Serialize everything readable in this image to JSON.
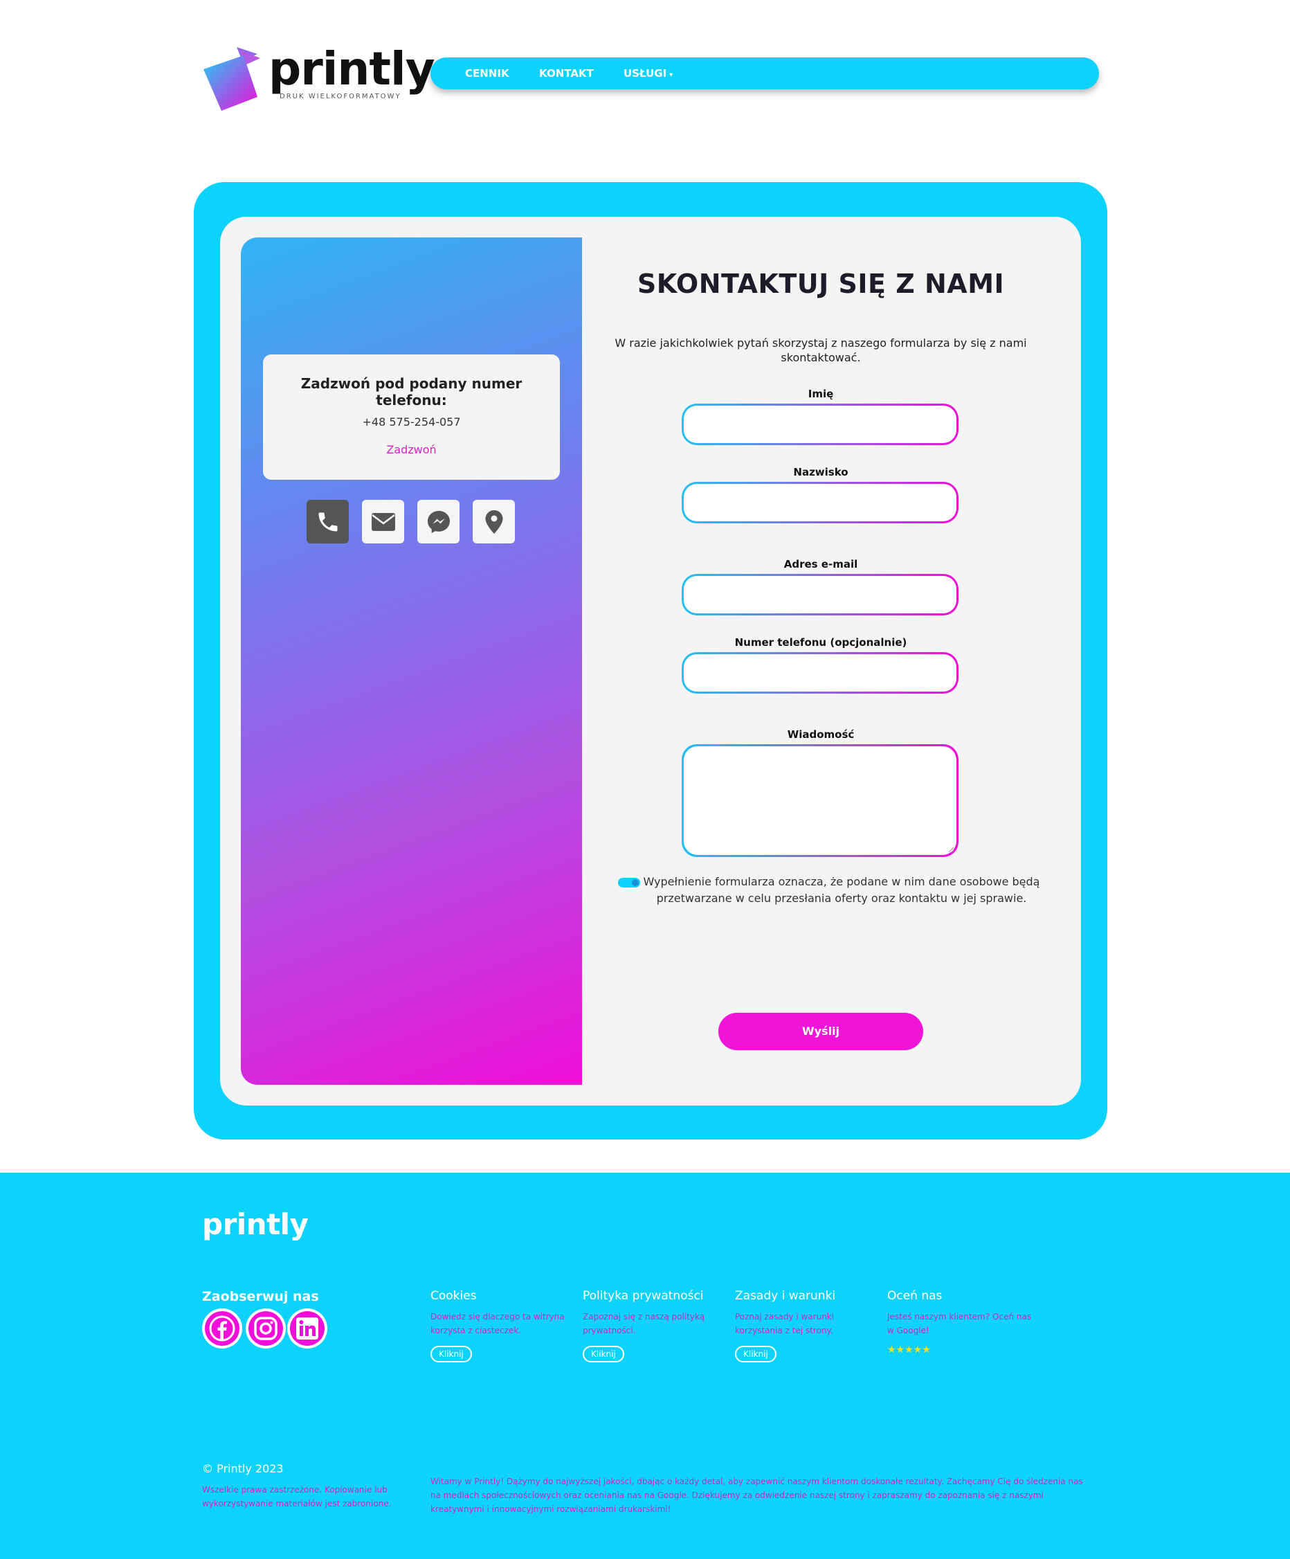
{
  "brand": {
    "name": "printly",
    "tagline": "DRUK WIELKOFORMATOWY"
  },
  "nav": {
    "items": [
      {
        "label": "CENNIK"
      },
      {
        "label": "KONTAKT"
      },
      {
        "label": "USŁUGI"
      }
    ],
    "dropdown_caret": "▾"
  },
  "call_card": {
    "title": "Zadzwoń pod podany numer telefonu:",
    "phone": "+48 575-254-057",
    "link": "Zadzwoń"
  },
  "contact_icons": [
    "phone-icon",
    "envelope-icon",
    "messenger-icon",
    "map-pin-icon"
  ],
  "form": {
    "title": "SKONTAKTUJ SIĘ Z NAMI",
    "intro": "W razie jakichkolwiek pytań skorzystaj z naszego formularza by się z nami skontaktować.",
    "fields": [
      {
        "label": "Imię",
        "value": ""
      },
      {
        "label": "Nazwisko",
        "value": ""
      },
      {
        "label": "Adres e-mail",
        "value": ""
      },
      {
        "label": "Numer telefonu (opcjonalnie)",
        "value": ""
      },
      {
        "label": "Wiadomość",
        "value": ""
      }
    ],
    "consent": "Wypełnienie formularza oznacza, że podane w nim dane osobowe będą przetwarzane w celu przesłania oferty oraz kontaktu w jej sprawie.",
    "consent_checked": true,
    "submit_label": "Wyślij"
  },
  "footer": {
    "logo": "printly",
    "follow_label": "Zaobserwuj nas",
    "social_icons": [
      "facebook-icon",
      "instagram-icon",
      "linkedin-icon"
    ],
    "columns": [
      {
        "heading": "Cookies",
        "text": "Dowiedz się dlaczego ta witryna korzysta z ciasteczek.",
        "button": "Kliknij"
      },
      {
        "heading": "Polityka prywatności",
        "text": "Zapoznaj się z naszą polityką prywatności.",
        "button": "Kliknij"
      },
      {
        "heading": "Zasady i warunki",
        "text": "Poznaj zasady i warunki korzystania z tej strony.",
        "button": "Kliknij"
      },
      {
        "heading": "Oceń nas",
        "text": "Jesteś naszym klientem? Oceń nas w Google!",
        "stars": "★★★★★"
      }
    ],
    "copyright": "© Printly 2023",
    "rights": "Wszelkie prawa zastrzeżone. Kopiowanie lub wykorzystywanie materiałów jest zabronione.",
    "welcome": "Witamy w Printly! Dążymy do najwyższej jakości, dbając o każdy detal, aby zapewnić naszym klientom doskonałe rezultaty. Zachęcamy Cię do śledzenia nas na mediach społecznościowych oraz oceniania nas na Google. Dziękujemy za odwiedzenie naszej strony i zapraszamy do zapoznania się z naszymi kreatywnymi i innowacyjnymi rozwiązaniami drukarskimi!"
  },
  "colors": {
    "accent": "#0cd2fc",
    "magenta": "#f00ed8",
    "panel": "#f4f4f4"
  }
}
